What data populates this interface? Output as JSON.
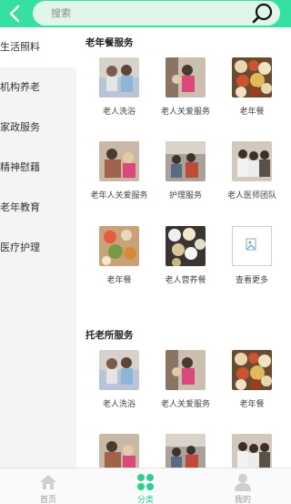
{
  "search": {
    "placeholder": "搜索"
  },
  "sidebar": {
    "items": [
      {
        "label": "生活照料",
        "active": true
      },
      {
        "label": "机构养老",
        "active": false
      },
      {
        "label": "家政服务",
        "active": false
      },
      {
        "label": "精神慰藉",
        "active": false
      },
      {
        "label": "老年教育",
        "active": false
      },
      {
        "label": "医疗护理",
        "active": false
      }
    ]
  },
  "sections": [
    {
      "title": "老年餐服务",
      "items": [
        {
          "label": "老人洗浴",
          "icon": "bathing-photo"
        },
        {
          "label": "老人关爱服务",
          "icon": "care-photo"
        },
        {
          "label": "老年餐",
          "icon": "meal-photo"
        },
        {
          "label": "老年人关爱服务",
          "icon": "care-photo"
        },
        {
          "label": "护理服务",
          "icon": "nursing-photo"
        },
        {
          "label": "老人医师团队",
          "icon": "doctor-team-photo"
        },
        {
          "label": "老年餐",
          "icon": "meal-photo-2"
        },
        {
          "label": "老人营养餐",
          "icon": "nutrition-meal-photo"
        },
        {
          "label": "查看更多",
          "icon": "broken-image-icon"
        }
      ]
    },
    {
      "title": "托老所服务",
      "items": [
        {
          "label": "老人洗浴",
          "icon": "bathing-photo"
        },
        {
          "label": "老人关爱服务",
          "icon": "care-photo"
        },
        {
          "label": "老年餐",
          "icon": "meal-photo"
        },
        {
          "label": "",
          "icon": "care-photo"
        },
        {
          "label": "",
          "icon": "nursing-photo"
        },
        {
          "label": "",
          "icon": "doctor-team-photo"
        }
      ]
    }
  ],
  "tabbar": {
    "tabs": [
      {
        "label": "首页",
        "icon": "home-icon",
        "active": false
      },
      {
        "label": "分类",
        "icon": "category-icon",
        "active": true
      },
      {
        "label": "我的",
        "icon": "profile-icon",
        "active": false
      }
    ]
  },
  "colors": {
    "accent": "#36e0a3",
    "active_tab": "#2fcf8c"
  }
}
